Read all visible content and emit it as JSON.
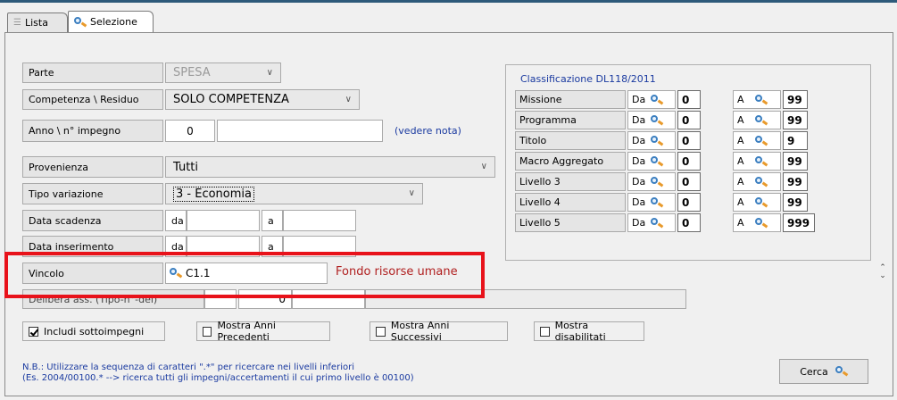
{
  "tabs": [
    {
      "label": "Lista",
      "icon": "list-icon"
    },
    {
      "label": "Selezione",
      "icon": "search-icon"
    }
  ],
  "form": {
    "parte": {
      "label": "Parte",
      "value": "SPESA"
    },
    "competenza": {
      "label": "Competenza \\ Residuo",
      "value": "SOLO COMPETENZA"
    },
    "anno": {
      "label": "Anno \\ n° impegno",
      "value": "0",
      "value2": "",
      "note_link": "(vedere nota)"
    },
    "provenienza": {
      "label": "Provenienza",
      "value": "Tutti"
    },
    "tipo_variazione": {
      "label": "Tipo variazione",
      "value": "3 - Economia"
    },
    "data_scadenza": {
      "label": "Data scadenza",
      "da": "da",
      "a": "a",
      "from_value": "",
      "to_value": ""
    },
    "data_inserimento": {
      "label": "Data inserimento",
      "da": "da",
      "a": "a",
      "from_value": "",
      "to_value": ""
    },
    "vincolo": {
      "label": "Vincolo",
      "value": "C1.1",
      "description": "Fondo risorse umane"
    },
    "delibera": {
      "label": "Delibera ass. (Tipo-n°-del)",
      "value1": "",
      "value2": "0",
      "value3": ""
    }
  },
  "classificazione": {
    "title": "Classificazione DL118/2011",
    "da_label": "Da",
    "a_label": "A",
    "rows": [
      {
        "label": "Missione",
        "from": "0",
        "to": "99"
      },
      {
        "label": "Programma",
        "from": "0",
        "to": "99"
      },
      {
        "label": "Titolo",
        "from": "0",
        "to": "9"
      },
      {
        "label": "Macro Aggregato",
        "from": "0",
        "to": "99"
      },
      {
        "label": "Livello 3",
        "from": "0",
        "to": "99"
      },
      {
        "label": "Livello 4",
        "from": "0",
        "to": "99"
      },
      {
        "label": "Livello 5",
        "from": "0",
        "to": "999"
      }
    ]
  },
  "checkboxes": [
    {
      "label": "Includi sottoimpegni",
      "checked": true
    },
    {
      "label": "Mostra Anni Precedenti",
      "checked": false
    },
    {
      "label": "Mostra Anni Successivi",
      "checked": false
    },
    {
      "label": "Mostra disabilitati",
      "checked": false
    }
  ],
  "note": {
    "line1": "N.B.: Utilizzare la sequenza di caratteri \".*\" per ricercare nei livelli inferiori",
    "line2": "(Es. 2004/00100.* --> ricerca tutti gli impegni/accertamenti il cui primo livello è 00100)"
  },
  "cerca_button": {
    "label": "Cerca"
  },
  "colors": {
    "highlight": "#e8121a",
    "link": "#1a3aa0",
    "description": "#b02020"
  }
}
